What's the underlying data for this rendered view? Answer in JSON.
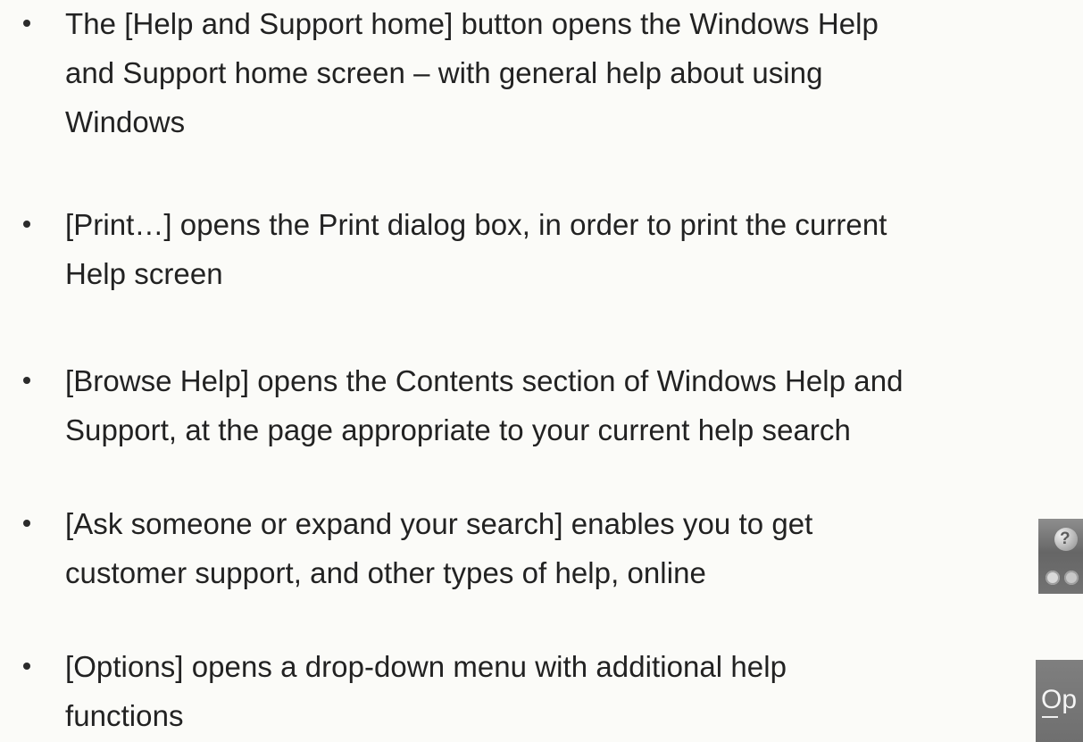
{
  "items": [
    {
      "lines": [
        "The [Help and Support home] button opens the Windows Help",
        "and Support home screen – with general help about using",
        "Windows"
      ]
    },
    {
      "lines": [
        "[Print…] opens the Print dialog box, in order to print the current",
        "Help screen"
      ]
    },
    {
      "lines": [
        "[Browse Help] opens the Contents section of Windows Help and",
        "Support, at the page appropriate to your current help search"
      ]
    },
    {
      "lines": [
        "[Ask someone or expand your search] enables you to get",
        "customer support, and other types of help, online"
      ]
    },
    {
      "lines": [
        "[Options] opens a drop-down menu with additional help",
        "functions"
      ]
    }
  ],
  "icons": {
    "help_icon": "ask-someone-icon",
    "help_icon_glyph": "?",
    "options_icon": "options-icon",
    "options_label": "Op"
  }
}
